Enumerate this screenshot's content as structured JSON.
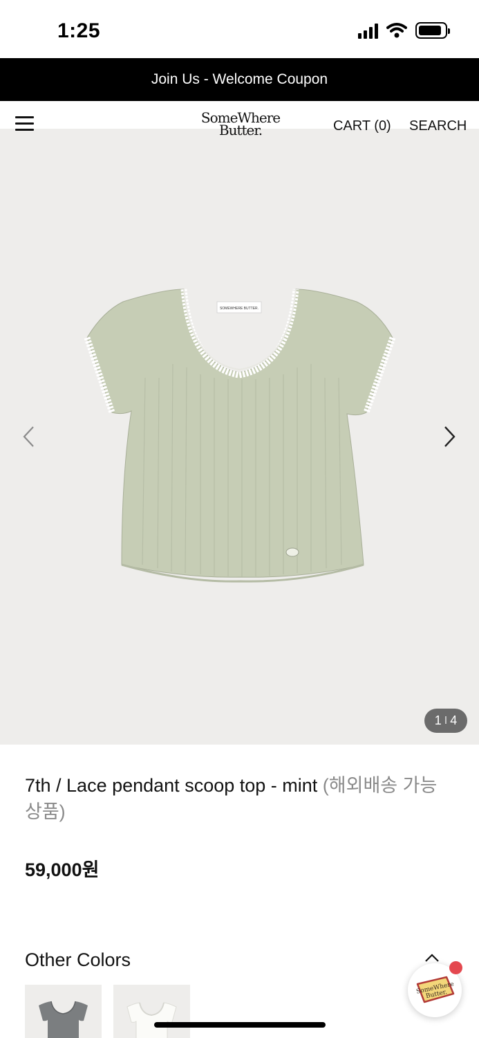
{
  "status_bar": {
    "time": "1:25",
    "battery_level": 0.9
  },
  "promo_banner": {
    "text": "Join Us - Welcome Coupon"
  },
  "header": {
    "logo_line1": "SomeWhere",
    "logo_line2": "Butter.",
    "cart_label": "CART (0)",
    "search_label": "SEARCH"
  },
  "gallery": {
    "current": "1",
    "separator": "I",
    "total": "4",
    "label_text": "SOMEWHERE BUTTER."
  },
  "product": {
    "title": "7th / Lace pendant scoop top - mint",
    "shipping_note": "(해외배송 가능상품)",
    "price": "59,000원"
  },
  "colors": {
    "heading": "Other Colors",
    "swatches": [
      "gray",
      "white"
    ]
  },
  "chat_badge": {
    "logo_line1": "SomeWhere",
    "logo_line2": "Butter."
  },
  "palette": {
    "banner_bg": "#000000",
    "gallery_bg": "#eeedeb",
    "shirt_mint": "#c6cdb5",
    "lace_white": "#ffffff",
    "muted_text": "#8a8a8a",
    "notification_dot": "#e4484f"
  }
}
